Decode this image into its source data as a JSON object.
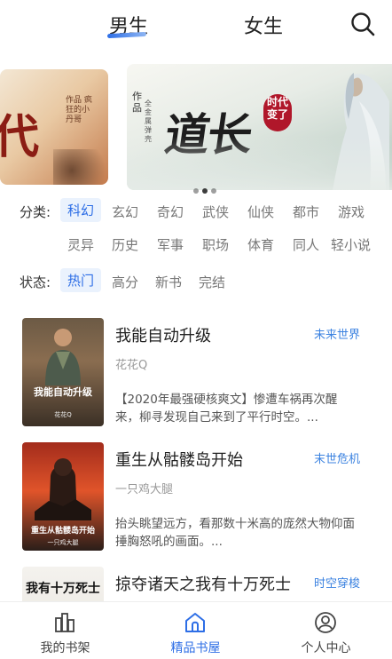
{
  "header": {
    "tabs": [
      {
        "label": "男生",
        "active": true
      },
      {
        "label": "女生",
        "active": false
      }
    ],
    "search_icon": "search-icon",
    "accent_color": "#2d6ee6"
  },
  "banner": {
    "left_card": {
      "big_text": "代",
      "side_text": "作品 疯狂的小丹哥"
    },
    "main_card": {
      "title": "道长",
      "seal": "时代变了",
      "vertical_title": "作品",
      "vertical_author": "全金属弹壳"
    },
    "dots_count": 3,
    "active_dot": 1
  },
  "filters": {
    "category_label": "分类:",
    "categories_row1": [
      "科幻",
      "玄幻",
      "奇幻",
      "武侠",
      "仙侠",
      "都市",
      "游戏"
    ],
    "categories_row2": [
      "灵异",
      "历史",
      "军事",
      "职场",
      "体育",
      "同人",
      "轻小说"
    ],
    "selected_category": "科幻",
    "status_label": "状态:",
    "statuses": [
      "热门",
      "高分",
      "新书",
      "完结"
    ],
    "selected_status": "热门"
  },
  "books": [
    {
      "title": "我能自动升级",
      "genre": "未来世界",
      "author": "花花Q",
      "desc": "【2020年最强硬核爽文】惨遭车祸再次醒来，柳寻发现自己来到了平行时空。...",
      "cover_title": "我能自动升级",
      "cover_author": "花花Q"
    },
    {
      "title": "重生从骷髅岛开始",
      "genre": "末世危机",
      "author": "一只鸡大腿",
      "desc": "抬头眺望远方，看那数十米高的庞然大物仰面捶胸怒吼的画面。...",
      "cover_title": "重生从骷髅岛开始",
      "cover_author": "一只鸡大腿"
    },
    {
      "title": "掠夺诸天之我有十万死士",
      "genre": "时空穿梭",
      "author": "",
      "desc": "",
      "cover_title": "我有十万死士",
      "cover_author": ""
    }
  ],
  "bottom_nav": [
    {
      "label": "我的书架",
      "icon": "bookshelf-icon",
      "active": false
    },
    {
      "label": "精品书屋",
      "icon": "home-icon",
      "active": true
    },
    {
      "label": "个人中心",
      "icon": "profile-icon",
      "active": false
    }
  ]
}
